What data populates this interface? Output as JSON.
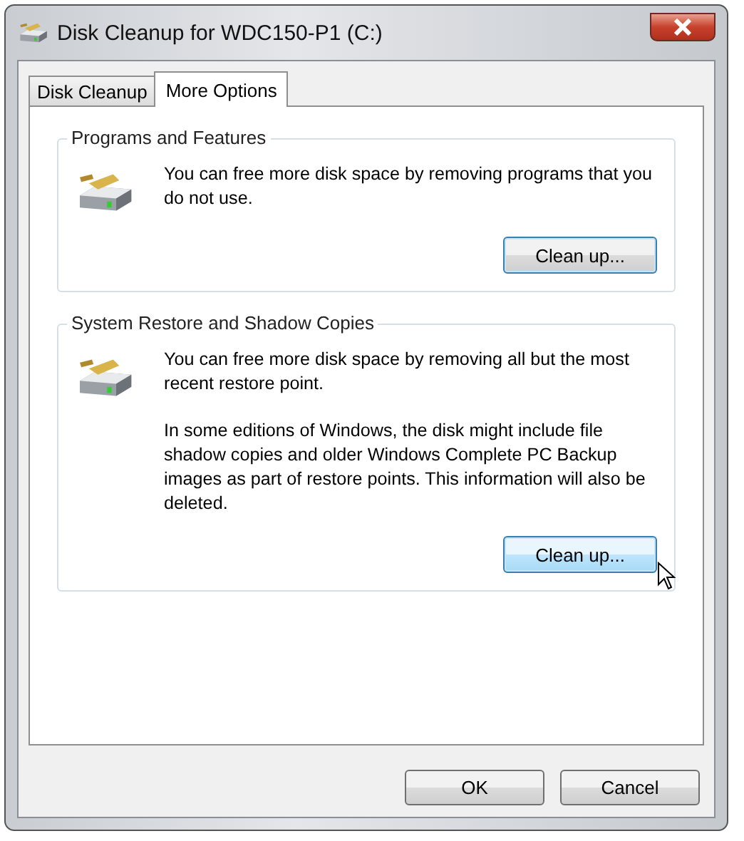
{
  "window": {
    "title": "Disk Cleanup for WDC150-P1 (C:)"
  },
  "tabs": [
    {
      "label": "Disk Cleanup",
      "selected": false
    },
    {
      "label": "More Options",
      "selected": true
    }
  ],
  "groups": [
    {
      "title": "Programs and Features",
      "paragraphs": [
        "You can free more disk space by removing programs that you do not use."
      ],
      "button": {
        "label": "Clean up...",
        "hovered": false
      }
    },
    {
      "title": "System Restore and Shadow Copies",
      "paragraphs": [
        "You can free more disk space by removing all but the most recent restore point.",
        "In some editions of Windows, the disk might include file shadow copies and older Windows Complete PC Backup images as part of restore points. This information will also be deleted."
      ],
      "button": {
        "label": "Clean up...",
        "hovered": true
      }
    }
  ],
  "buttons": [
    {
      "label": "OK"
    },
    {
      "label": "Cancel"
    }
  ]
}
